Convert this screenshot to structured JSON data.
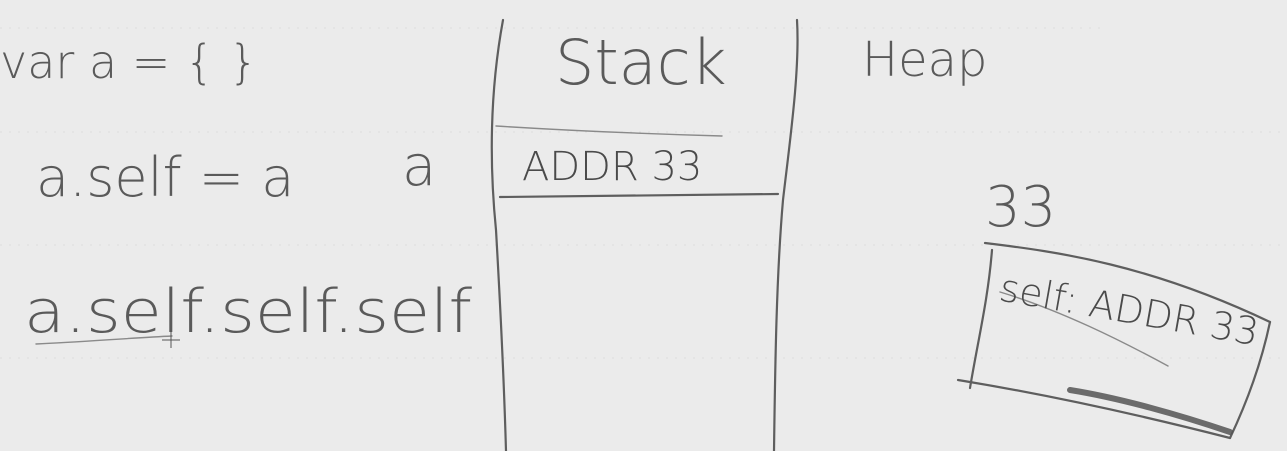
{
  "code": {
    "line1": "var a = { }",
    "line2": "a.self = a",
    "line3": "a.self.self.self",
    "var_label": "a"
  },
  "stack": {
    "title": "Stack",
    "entry": "ADDR 33"
  },
  "heap": {
    "title": "Heap",
    "object_address": "33",
    "object_content": "self: ADDR 33"
  }
}
